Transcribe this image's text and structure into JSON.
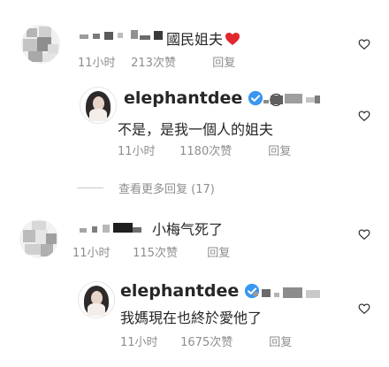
{
  "comments": [
    {
      "text": "國民姐夫",
      "time": "11小时",
      "likes": "213次赞",
      "reply": "回复"
    },
    {
      "username": "elephantdee",
      "mention": "@",
      "text": "不是，是我一個人的姐夫",
      "time": "11小时",
      "likes": "1180次赞",
      "reply": "回复"
    },
    {
      "view_more": "查看更多回复 (17)"
    },
    {
      "text": "小梅气死了",
      "time": "11小时",
      "likes": "115次赞",
      "reply": "回复"
    },
    {
      "username": "elephantdee",
      "text": "我媽現在也終於愛他了",
      "time": "11小时",
      "likes": "1675次赞",
      "reply": "回复"
    }
  ],
  "colors": {
    "text": "#262626",
    "secondary": "#8e8e8e",
    "verified": "#3897f0",
    "heart_emoji": "#e0282e"
  },
  "icons": [
    "heart-outline-icon",
    "verified-badge-icon",
    "red-heart-emoji"
  ]
}
